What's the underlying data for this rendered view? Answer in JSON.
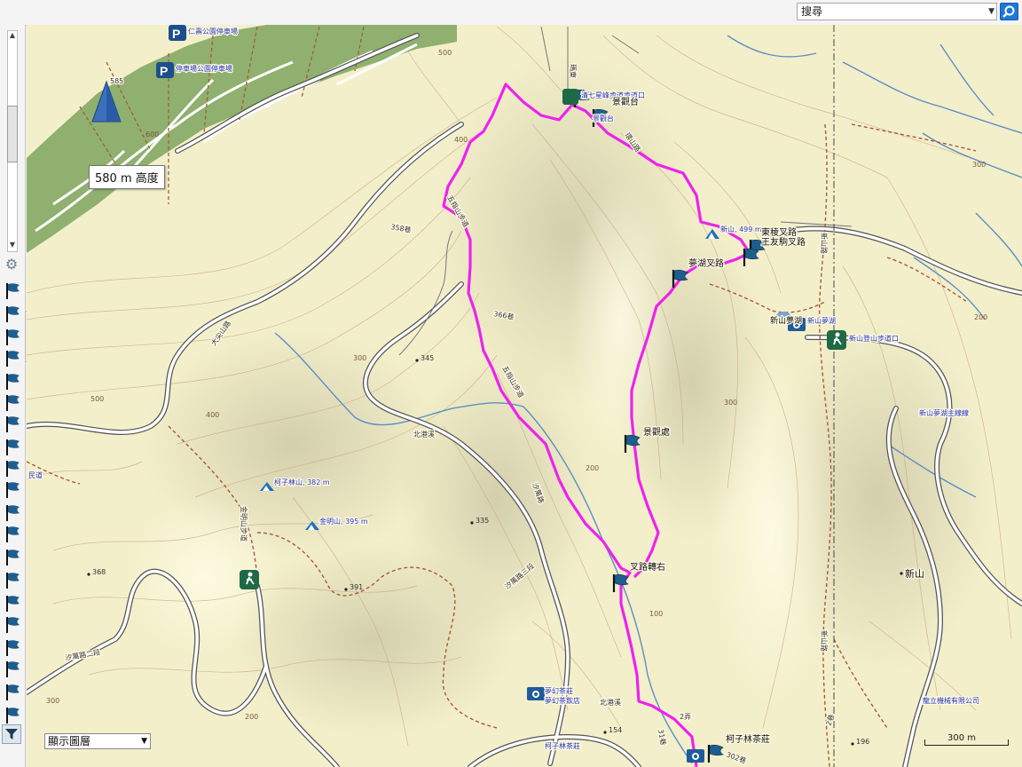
{
  "search": {
    "placeholder": "搜尋"
  },
  "elevation_tooltip": "580 m 高度",
  "layer_select": {
    "value": "顯示圖層"
  },
  "scale": "300 m",
  "colors": {
    "track": "#ee22ee",
    "greenbelt": "#7ca45e",
    "river": "#5b8fc6",
    "trail": "#a85a38",
    "paper": "#f5f1c9"
  },
  "icons": {
    "peak": "blue-pyramid-peak-icon",
    "parking": "parking-icon",
    "waypoint": "waypoint-flag-icon",
    "camera": "camera-icon",
    "trailhead": "hiker-trailhead-icon"
  },
  "peak_label": "585",
  "parking_labels": [
    "仁壽公園停車場",
    "停車場公園停車場"
  ],
  "waypoints": {
    "jingguantai": "景觀台",
    "dongshan_jct": "東稜叉路",
    "wangyou_jct": "王友駒叉路",
    "menghu_jct": "夢湖叉路",
    "jingguanchu": "景觀處",
    "chalu": "叉路轉右",
    "kezilin_tea": "柯子林茶莊"
  },
  "blue_labels": {
    "trailhead_top": "清七星峰步道步道口",
    "jingguantai_small": "景觀台",
    "xinshan_peak": "新山, 499 m",
    "xinshan_menghu_cam": "新山夢湖",
    "xinshan_menghu": "新山夢湖",
    "xinshan_trailhead": "新山登山步道口",
    "xinshan_lake_trail": "新山夢湖主線線",
    "kezilinshan": "柯子林山, 382 m",
    "jinmingshan": "金明山, 395 m",
    "kezilin_cam": "柯子林茶莊",
    "cam_lower": "夢幻茶莊",
    "lower_shop": "夢幻茶飲店",
    "company": "龍立機械有限公司",
    "yongtong": "民道"
  },
  "road_labels": [
    "北港溪",
    "北港溪",
    "汐萬路三段",
    "汐萬路二段",
    "汐萬路",
    "新山路",
    "新山路",
    "瑪東",
    "金明山步道",
    "五指山步道",
    "五指山步道",
    "環山路",
    "大尖山路",
    "358巷",
    "366巷",
    "302巷",
    "2弄",
    "31巷",
    "2巷"
  ],
  "contour_labels": [
    "500",
    "400",
    "400",
    "300",
    "300",
    "300",
    "200",
    "200",
    "200",
    "100",
    "600",
    "500",
    "300"
  ],
  "spot_heights": [
    "345",
    "335",
    "368",
    "391",
    "154",
    "196"
  ],
  "place_xinshan": "新山"
}
